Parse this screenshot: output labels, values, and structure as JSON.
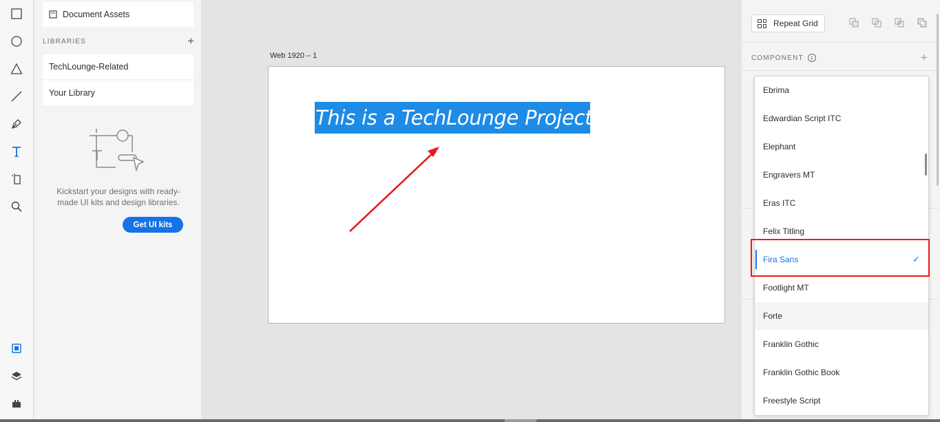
{
  "toolbar": {
    "tools": [
      {
        "name": "rectangle-tool",
        "icon": "rectangle-icon"
      },
      {
        "name": "ellipse-tool",
        "icon": "ellipse-icon"
      },
      {
        "name": "polygon-tool",
        "icon": "triangle-icon"
      },
      {
        "name": "line-tool",
        "icon": "line-icon"
      },
      {
        "name": "pen-tool",
        "icon": "pen-icon"
      },
      {
        "name": "text-tool",
        "icon": "text-icon",
        "active": true
      },
      {
        "name": "artboard-tool",
        "icon": "artboard-icon"
      },
      {
        "name": "zoom-tool",
        "icon": "search-icon"
      }
    ],
    "bottom_tools": [
      {
        "name": "assets-panel",
        "icon": "assets-icon",
        "active": true
      },
      {
        "name": "layers-panel",
        "icon": "layers-icon"
      },
      {
        "name": "plugins-panel",
        "icon": "plugins-icon"
      }
    ]
  },
  "assets": {
    "document_assets": "Document Assets",
    "libraries_title": "LIBRARIES",
    "libraries": [
      "TechLounge-Related",
      "Your Library"
    ],
    "kickstart_text": "Kickstart your designs with ready-made UI kits and design libraries.",
    "get_kits_label": "Get UI kits"
  },
  "canvas": {
    "artboard_name": "Web 1920 – 1",
    "selected_text": "This is a TechLounge Project"
  },
  "right_panel": {
    "repeat_grid_label": "Repeat Grid",
    "component_title": "COMPONENT",
    "info_glyph": "i"
  },
  "font_dropdown": {
    "items": [
      "Ebrima",
      "Edwardian Script ITC",
      "Elephant",
      "Engravers MT",
      "Eras ITC",
      "Felix Titling",
      "Fira Sans",
      "Footlight MT",
      "Forte",
      "Franklin Gothic",
      "Franklin Gothic Book",
      "Freestyle Script"
    ],
    "selected": "Fira Sans",
    "hovered": "Forte"
  },
  "colors": {
    "accent": "#1473e6",
    "selection": "#1e8be6",
    "annotation_red": "#e8191c"
  }
}
